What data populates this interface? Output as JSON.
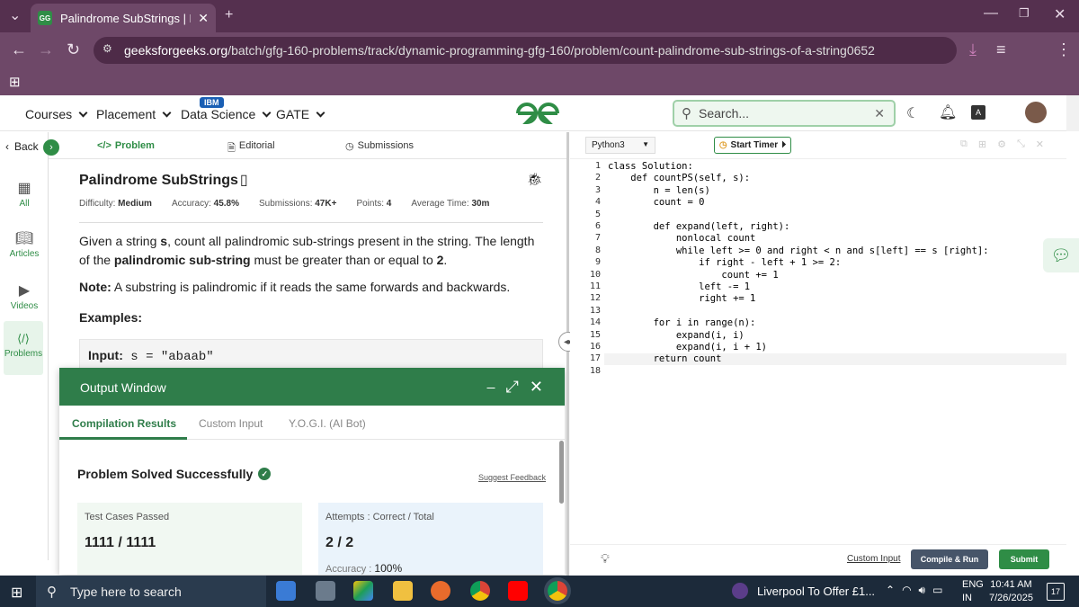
{
  "browser": {
    "tab_title": "Palindrome SubStrings | Practic",
    "new_tab": "+",
    "url_host": "geeksforgeeks.org",
    "url_path": "/batch/gfg-160-problems/track/dynamic-programming-gfg-160/problem/count-palindrome-sub-strings-of-a-string0652"
  },
  "site": {
    "nav": [
      "Courses",
      "Placement",
      "Data Science",
      "GATE"
    ],
    "ibm_badge": "IBM",
    "search_placeholder": "Search..."
  },
  "rail": {
    "back": "Back",
    "items": [
      "All",
      "Articles",
      "Videos",
      "Problems"
    ]
  },
  "problem_tabs": [
    "Problem",
    "Editorial",
    "Submissions"
  ],
  "problem": {
    "title": "Palindrome SubStrings",
    "difficulty_label": "Difficulty:",
    "difficulty": "Medium",
    "accuracy_label": "Accuracy:",
    "accuracy": "45.8%",
    "submissions_label": "Submissions:",
    "submissions": "47K+",
    "points_label": "Points:",
    "points": "4",
    "time_label": "Average Time:",
    "time": "30m",
    "desc_1": "Given a string ",
    "desc_s": "s",
    "desc_2": ", count all palindromic sub-strings present in the string. The length of the ",
    "desc_bold": "palindromic sub-string",
    "desc_3": " must be greater than or equal to ",
    "desc_num": "2",
    "desc_end": ".",
    "note_label": "Note:",
    "note_text": " A substring is palindromic if it reads the same forwards and backwards.",
    "examples": "Examples:",
    "input_label": "Input:",
    "input_value": " s = \"abaab\""
  },
  "output_window": {
    "title": "Output Window",
    "tabs": [
      "Compilation Results",
      "Custom Input",
      "Y.O.G.I. (AI Bot)"
    ],
    "status": "Problem Solved Successfully",
    "feedback": "Suggest Feedback",
    "tests_label": "Test Cases Passed",
    "tests_value": "1111 / 1111",
    "attempts_label": "Attempts : Correct / Total",
    "attempts_value": "2 / 2",
    "accuracy_label": "Accuracy :",
    "accuracy_value": "100%"
  },
  "editor": {
    "language": "Python3",
    "timer": "Start Timer",
    "lines": [
      "class Solution:",
      "    def countPS(self, s):",
      "        n = len(s)",
      "        count = 0",
      "",
      "        def expand(left, right):",
      "            nonlocal count",
      "            while left >= 0 and right < n and s[left] == s [right]:",
      "                if right - left + 1 >= 2:",
      "                    count += 1",
      "                left -= 1",
      "                right += 1",
      "",
      "        for i in range(n):",
      "            expand(i, i)",
      "            expand(i, i + 1)",
      "        return count",
      ""
    ],
    "line_numbers": [
      "1",
      "2",
      "3",
      "4",
      "5",
      "6",
      "7",
      "8",
      "9",
      "10",
      "11",
      "12",
      "13",
      "14",
      "15",
      "16",
      "17",
      "18"
    ],
    "custom_input": "Custom Input",
    "compile": "Compile & Run",
    "submit": "Submit"
  },
  "taskbar": {
    "search": "Type here to search",
    "news": "Liverpool To Offer £1...",
    "lang1": "ENG",
    "lang2": "IN",
    "time": "10:41 AM",
    "date": "7/26/2025",
    "notif": "17"
  }
}
